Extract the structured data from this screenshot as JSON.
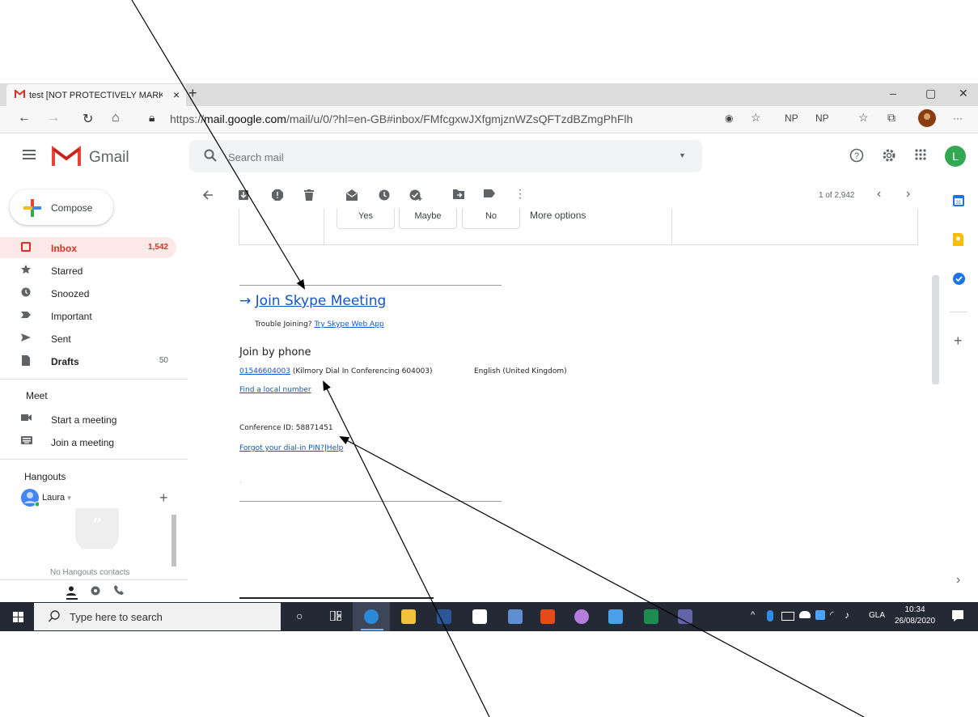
{
  "browser": {
    "tab_title": "test [NOT PROTECTIVELY MARKE",
    "tab_close": "×",
    "new_tab": "+",
    "url_prefix": "https://",
    "url_host": "mail.google.com",
    "url_path": "/mail/u/0/?hl=en-GB#inbox/FMfcgxwJXfgmjznWZsQFTzdBZmgPhFlh",
    "ext1": "NP",
    "ext2": "NP",
    "more": "···",
    "min": "–",
    "max": "▢",
    "close": "✕"
  },
  "gmail": {
    "product": "Gmail",
    "search_placeholder": "Search mail",
    "avatar_letter": "L"
  },
  "sidebar": {
    "compose_label": "Compose",
    "items": [
      {
        "label": "Inbox",
        "count": "1,542"
      },
      {
        "label": "Starred",
        "count": ""
      },
      {
        "label": "Snoozed",
        "count": ""
      },
      {
        "label": "Important",
        "count": ""
      },
      {
        "label": "Sent",
        "count": ""
      },
      {
        "label": "Drafts",
        "count": "50"
      }
    ],
    "meet_header": "Meet",
    "meet_items": [
      "Start a meeting",
      "Join a meeting"
    ],
    "hangouts_header": "Hangouts",
    "hangouts_user": "Laura",
    "hangouts_caret": "▾",
    "hangouts_add": "+",
    "no_contacts": "No Hangouts contacts"
  },
  "toolbar": {
    "pager": "1 of 2,942",
    "prev": "‹",
    "next": "›"
  },
  "message": {
    "rsvp_yes": "Yes",
    "rsvp_maybe": "Maybe",
    "rsvp_no": "No",
    "rsvp_more": "More options",
    "join_arrow": "→",
    "join_link": "Join Skype Meeting",
    "trouble_text": "Trouble Joining?",
    "trouble_link": "Try Skype Web App",
    "join_by_phone": "Join by phone",
    "phone_number": "01546604003",
    "phone_desc": "(Kilmory Dial In Conferencing 604003)",
    "phone_lang": "English (United Kingdom)",
    "local_number": "Find a local number",
    "conference_id": "Conference ID: 58871451",
    "forgot_pin": "Forgot your dial-in PIN?",
    "help": "Help",
    "dot": "."
  },
  "sidepanel": {
    "add": "+",
    "expand": "›"
  },
  "taskbar": {
    "search_placeholder": "Type here to search",
    "lang": "GLA",
    "time": "10:34",
    "date": "26/08/2020"
  }
}
